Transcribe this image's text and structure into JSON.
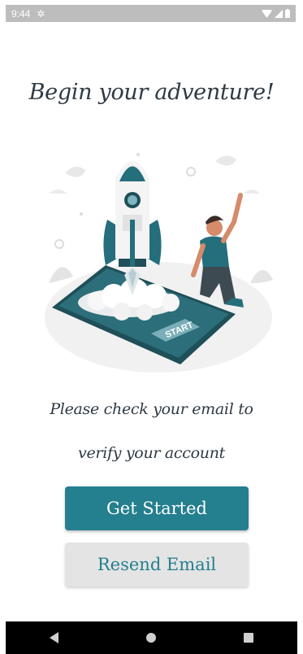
{
  "status_bar": {
    "time": "9:44",
    "icons": [
      "settings-icon",
      "wifi-icon",
      "signal-icon",
      "battery-icon"
    ]
  },
  "screen": {
    "title": "Begin your adventure!",
    "illustration": {
      "icon": "rocket-launch-illustration",
      "start_label": "START"
    },
    "message_line1": "Please check your email to",
    "message_line2": "verify your account"
  },
  "buttons": {
    "get_started": "Get Started",
    "resend_email": "Resend Email"
  },
  "nav_bar": {
    "icons": [
      "back-icon",
      "home-icon",
      "recents-icon"
    ]
  },
  "colors": {
    "primary": "#247f8f",
    "secondary_bg": "#e4e4e4",
    "text": "#2f3a44",
    "status_bar": "#bdbdbd",
    "nav_bar": "#000000"
  }
}
